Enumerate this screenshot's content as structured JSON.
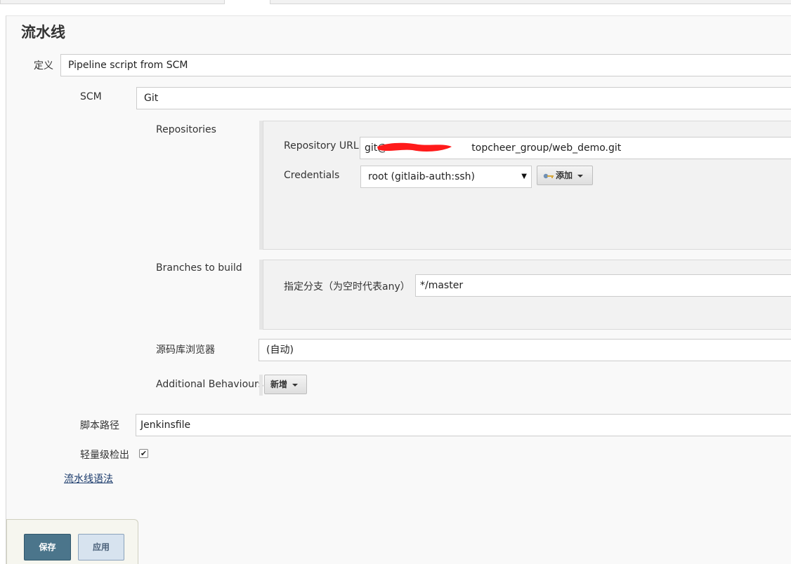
{
  "section": {
    "title": "流水线"
  },
  "definition": {
    "label": "定义",
    "value": "Pipeline script from SCM"
  },
  "scm": {
    "label": "SCM",
    "value": "Git"
  },
  "repositories": {
    "label": "Repositories",
    "url_label": "Repository URL",
    "url_prefix": "git@",
    "url_suffix": "topcheer_group/web_demo.git",
    "credentials_label": "Credentials",
    "credentials_value": "root (gitlaib-auth:ssh)",
    "add_label": "添加"
  },
  "branches": {
    "label": "Branches to build",
    "specifier_label": "指定分支（为空时代表any）",
    "specifier_value": "*/master"
  },
  "browser": {
    "label": "源码库浏览器",
    "value": "(自动)"
  },
  "behaviours": {
    "label": "Additional Behaviours",
    "add_label": "新增"
  },
  "script_path": {
    "label": "脚本路径",
    "value": "Jenkinsfile"
  },
  "lightweight": {
    "label": "轻量级检出",
    "checked": true,
    "mark": "✔"
  },
  "syntax_link": "流水线语法",
  "footer": {
    "save_label": "保存",
    "apply_label": "应用"
  },
  "colors": {
    "save": "#4b758b",
    "apply": "#d7e3ef",
    "redaction": "#ff1a1a"
  },
  "icons": {
    "add": "key-icon",
    "select": "chevron-down-icon"
  }
}
